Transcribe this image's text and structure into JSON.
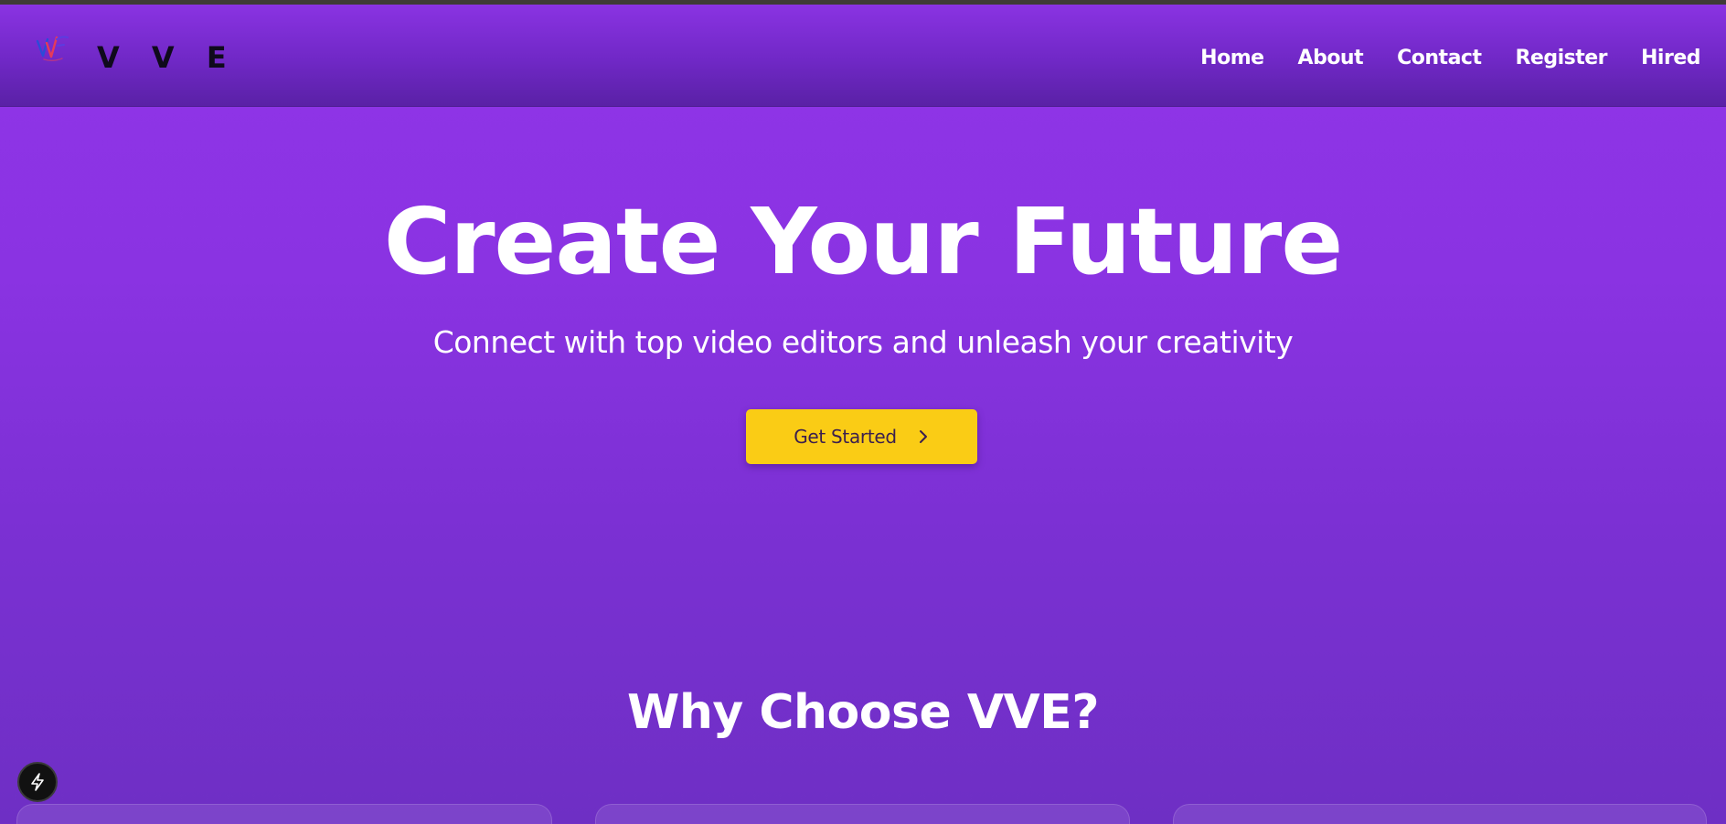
{
  "header": {
    "brand": "V V E",
    "nav": [
      "Home",
      "About",
      "Contact",
      "Register",
      "Hired"
    ]
  },
  "hero": {
    "title": "Create Your Future",
    "subtitle": "Connect with top video editors and unleash your creativity",
    "cta_label": "Get Started",
    "cta_icon": "chevron-right-icon"
  },
  "features": {
    "title": "Why Choose VVE?"
  },
  "floating_button_icon": "lightning-bolt-icon",
  "colors": {
    "background": "#8a33e2",
    "header_dark": "#5a21a6",
    "cta": "#facc15",
    "cta_text": "#3b1f4e",
    "brand_text": "#0f0a1c"
  }
}
